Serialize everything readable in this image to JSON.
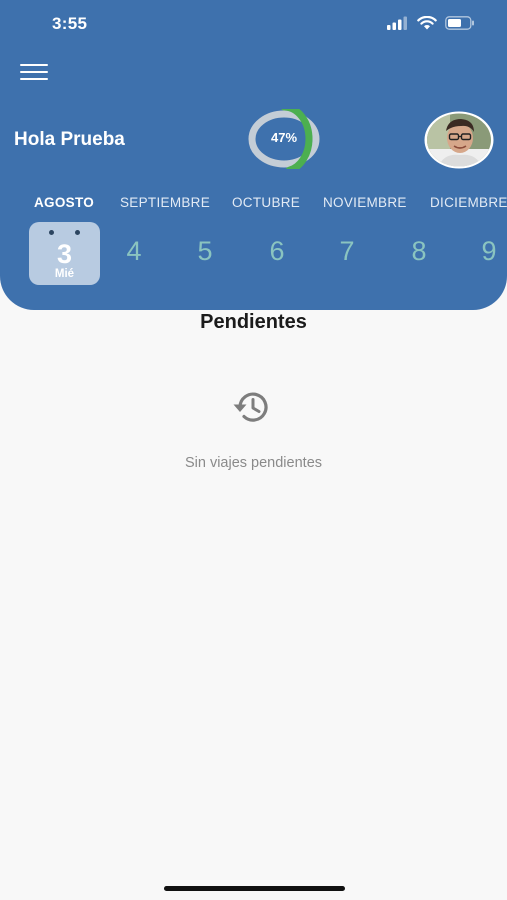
{
  "status_bar": {
    "time": "3:55"
  },
  "header": {
    "greeting": "Hola Prueba",
    "progress_label": "47%",
    "progress_value": 0.47,
    "progress_color": "#4caf50",
    "accent_color": "#3e71ad"
  },
  "months": [
    "AGOSTO",
    "SEPTIEMBRE",
    "OCTUBRE",
    "NOVIEMBRE",
    "DICIEMBRE"
  ],
  "active_month": "AGOSTO",
  "selected_day": {
    "number": "3",
    "weekday": "Mié"
  },
  "days": [
    "4",
    "5",
    "6",
    "7",
    "8",
    "9"
  ],
  "section": {
    "title": "Pendientes",
    "icon": "history-icon",
    "empty_text": "Sin viajes pendientes"
  }
}
